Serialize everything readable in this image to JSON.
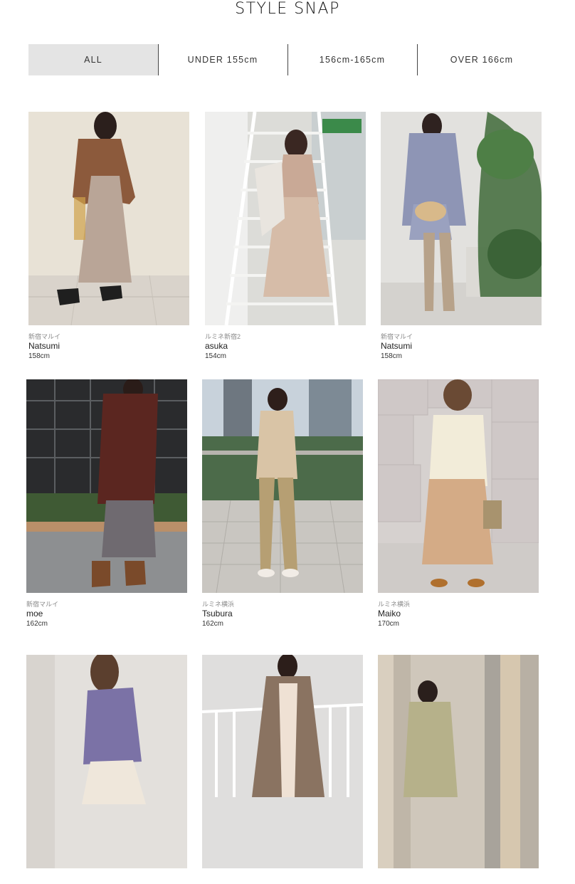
{
  "page": {
    "title": "STYLE SNAP"
  },
  "tabs": [
    {
      "label": "ALL",
      "active": true
    },
    {
      "label": "UNDER 155cm",
      "active": false
    },
    {
      "label": "156cm-165cm",
      "active": false
    },
    {
      "label": "OVER 166cm",
      "active": false
    }
  ],
  "snaps": [
    {
      "shop": "新宿マルイ",
      "name": "Natsumi",
      "height": "158cm"
    },
    {
      "shop": "ルミネ新宿2",
      "name": "asuka",
      "height": "154cm"
    },
    {
      "shop": "新宿マルイ",
      "name": "Natsumi",
      "height": "158cm"
    },
    {
      "shop": "新宿マルイ",
      "name": "moe",
      "height": "162cm"
    },
    {
      "shop": "ルミネ横浜",
      "name": "Tsubura",
      "height": "162cm"
    },
    {
      "shop": "ルミネ横浜",
      "name": "Maiko",
      "height": "170cm"
    },
    {
      "shop": "",
      "name": "",
      "height": ""
    },
    {
      "shop": "",
      "name": "",
      "height": ""
    },
    {
      "shop": "",
      "name": "",
      "height": ""
    }
  ]
}
